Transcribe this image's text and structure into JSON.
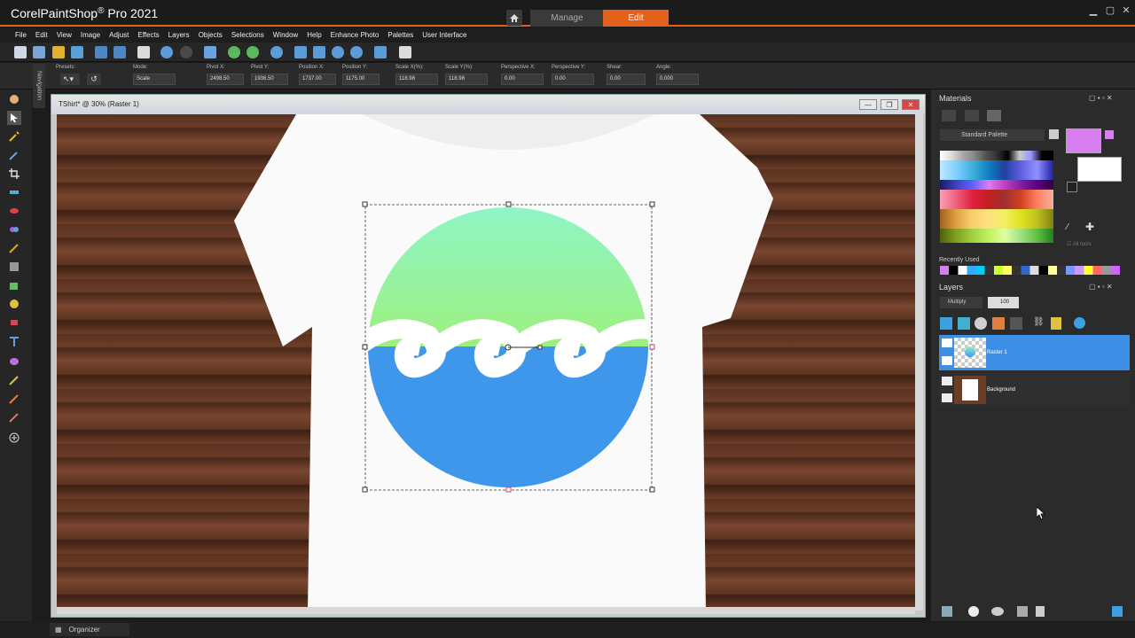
{
  "app": {
    "title_prefix": "Corel",
    "title_main": "PaintShop",
    "title_suffix": "Pro 2021"
  },
  "workspace_tabs": {
    "manage": "Manage",
    "edit": "Edit"
  },
  "menu": [
    "File",
    "Edit",
    "View",
    "Image",
    "Adjust",
    "Effects",
    "Layers",
    "Objects",
    "Selections",
    "Window",
    "Help",
    "Enhance Photo",
    "Palettes",
    "User Interface"
  ],
  "options": {
    "presets_label": "Presets:",
    "mode_label": "Mode:",
    "mode_value": "Scale",
    "fields": [
      {
        "label": "Pivot X:",
        "value": "2498.50"
      },
      {
        "label": "Pivot Y:",
        "value": "1936.50"
      },
      {
        "label": "Position X:",
        "value": "1737.00"
      },
      {
        "label": "Position Y:",
        "value": "1175.00"
      },
      {
        "label": "Scale X(%):",
        "value": "118.98"
      },
      {
        "label": "Scale Y(%):",
        "value": "118.98"
      },
      {
        "label": "Perspective X:",
        "value": "0.00"
      },
      {
        "label": "Perspective Y:",
        "value": "0.00"
      },
      {
        "label": "Shear:",
        "value": "0.00"
      },
      {
        "label": "Angle:",
        "value": "0.000"
      }
    ]
  },
  "navigation_tab": "Navigation",
  "document": {
    "title": "TShirt* @  30% (Raster 1)"
  },
  "materials": {
    "title": "Materials",
    "palette_select": "Standard Palette",
    "all_tools": "All tools",
    "recently_used": "Recently Used",
    "foreground_color": "#d97ef0"
  },
  "layers": {
    "title": "Layers",
    "blend_mode": "Multiply",
    "opacity": "100",
    "items": [
      {
        "name": "Raster 1",
        "selected": true
      },
      {
        "name": "Background",
        "selected": false
      }
    ]
  },
  "status": {
    "organizer": "Organizer"
  },
  "colors": {
    "accent": "#e2621d",
    "layer_selected": "#3d8fe6"
  }
}
